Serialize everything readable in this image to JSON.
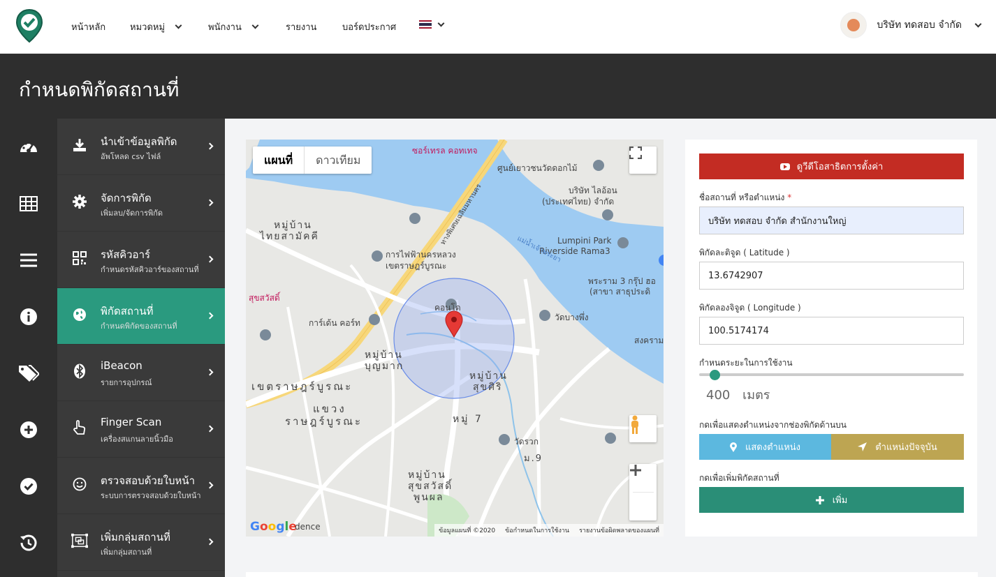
{
  "nav": {
    "home": "หน้าหลัก",
    "category": "หมวดหมู่",
    "employee": "พนักงาน",
    "report": "รายงาน",
    "board": "บอร์ดประกาศ",
    "company": "บริษัท ทดสอบ จำกัด"
  },
  "page": {
    "title": "กำหนดพิกัดสถานที่"
  },
  "sidebar": {
    "items": [
      {
        "title": "นำเข้าข้อมูลพิกัด",
        "sub": "อัพโหลด csv ไฟล์"
      },
      {
        "title": "จัดการพิกัด",
        "sub": "เพิ่มลบ/จัดการพิกัด"
      },
      {
        "title": "รหัสคิวอาร์",
        "sub": "กำหนดรหัสคิวอาร์ของสถานที่"
      },
      {
        "title": "พิกัดสถานที่",
        "sub": "กำหนดพิกัดของสถานที่"
      },
      {
        "title": "iBeacon",
        "sub": "รายการอุปกรณ์"
      },
      {
        "title": "Finger Scan",
        "sub": "เครื่องสแกนลายนิ้วมือ"
      },
      {
        "title": "ตรวจสอบด้วยใบหน้า",
        "sub": "ระบบการตรวจสอบด้วยใบหน้า"
      },
      {
        "title": "เพิ่มกลุ่มสถานที่",
        "sub": "เพิ่มกลุ่มสถานที่"
      }
    ]
  },
  "map": {
    "tab_map": "แผนที่",
    "tab_satellite": "ดาวเทียม",
    "footer_data": "ข้อมูลแผนที่ ©2020",
    "footer_terms": "ข้อกำหนดในการใช้งาน",
    "footer_report": "รายงานข้อผิดพลาดของแผนที่",
    "logo": "Google",
    "labels": {
      "l1": "ศูนย์เยาวชนวัดดอกไม้",
      "l2": "บริษัท ไลอ้อน",
      "l3": "(ประเทศไทย) จำกัด",
      "l4": "Lumpini Park",
      "l5": "Riverside Rama3",
      "l6": "หมู่บ้าน",
      "l7": "ไทยสามัคคี",
      "l8": "การไฟฟ้านครหลวง",
      "l9": "เขตราษฎร์บูรณะ",
      "l10": "แม่น้ำเจ้าพระยา",
      "l11": "พระราม 3 กรุ๊ป ฮอ",
      "l12": "(สาขา สาธุประดิ",
      "l13": "คอนโด",
      "l14": "วัดบางพึ่ง",
      "l15": "การ์เด้น คอร์ท",
      "l16": "หมู่บ้าน",
      "l17": "บุญมาก",
      "l18": "เขตราษฎร์บูรณะ",
      "l19": "แขวง",
      "l20": "ราษฎร์บูรณะ",
      "l21": "หมู่บ้าน",
      "l22": "สุขศิริ",
      "l23": "หมู่ 7",
      "l24": "วัดรวก",
      "l25": "ม.9",
      "l26": "หมู่บ้าน",
      "l27": "สุขสวัสดิ์",
      "l28": "พูนผล",
      "l29": "สุขสวัสดิ์",
      "l30": "ซอร์เทรล คอทเทจ",
      "l31": "สงคราม (พ",
      "l32": "ทางพิเศษเฉลิมมหานคร",
      "l33": "dence"
    }
  },
  "form": {
    "video_button": "ดูวีดีโอสาธิตการตั้งค่า",
    "name_label": "ชื่อสถานที่ หรือตำแหน่ง",
    "required_mark": "*",
    "name_value": "บริษัท ทดสอบ จำกัด สำนักงานใหญ่",
    "lat_label": "พิกัดละติจูด ( Latitude )",
    "lat_value": "13.6742907",
    "lng_label": "พิกัดลองจิจูด ( Longitude )",
    "lng_value": "100.5174174",
    "range_label": "กำหนดระยะในการใช้งาน",
    "range_value": "400",
    "range_unit": "เมตร",
    "range_fraction": 0.04,
    "show_label": "กดเพื่อแสดงตำแหน่งจากช่องพิกัดด้านบน",
    "show_button": "แสดงตำแหน่ง",
    "current_button": "ตำแหน่งปัจจุบัน",
    "add_label": "กดเพื่อเพิ่มพิกัดสถานที่",
    "add_button": "เพิ่ม"
  },
  "colors": {
    "active": "#2a9a7f",
    "video": "#c32c23",
    "show": "#5cb8df",
    "current": "#bda552",
    "add": "#2a8e77",
    "dark": "#2e2e2e"
  }
}
